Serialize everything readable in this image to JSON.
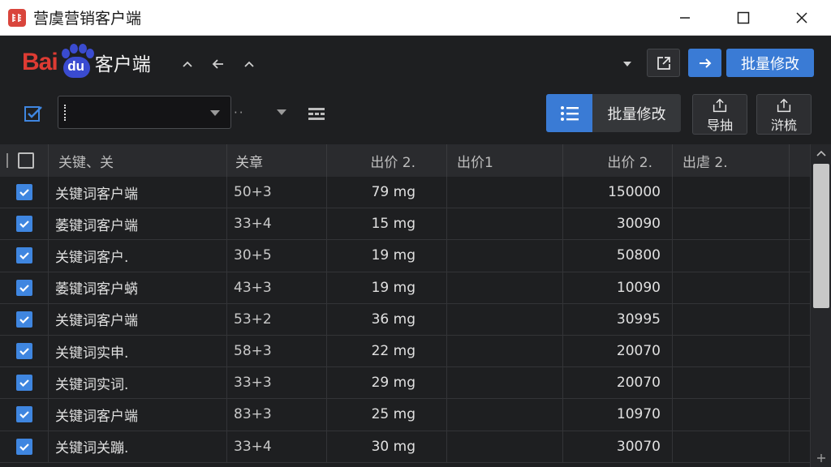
{
  "window": {
    "title": "营虞营销客户端"
  },
  "header": {
    "logo_bai": "Bai",
    "logo_du": "du",
    "logo_text": "客户端",
    "batch_edit_label": "批量修改"
  },
  "toolbar": {
    "dots": "··",
    "batch_edit_label": "批量修改",
    "export_label": "导抽",
    "more_label": "浒梳"
  },
  "table": {
    "columns": [
      "",
      "关键、关",
      "关章",
      "出价 2.",
      "出价1",
      "出价 2.",
      "出虐 2."
    ],
    "rows": [
      {
        "keyword": "关键词客户端",
        "match": "50+3",
        "dose": "79 mg",
        "bid1": "",
        "bid2": "150000",
        "bid3": ""
      },
      {
        "keyword": "萎键词客户端",
        "match": "33+4",
        "dose": "15 mg",
        "bid1": "",
        "bid2": "30090",
        "bid3": ""
      },
      {
        "keyword": "关键词客户.",
        "match": "30+5",
        "dose": "19 mg",
        "bid1": "",
        "bid2": "50800",
        "bid3": ""
      },
      {
        "keyword": "萎键词客户蜹",
        "match": "43+3",
        "dose": "19 mg",
        "bid1": "",
        "bid2": "10090",
        "bid3": ""
      },
      {
        "keyword": "关键词客户端",
        "match": "53+2",
        "dose": "36 mg",
        "bid1": "",
        "bid2": "30995",
        "bid3": ""
      },
      {
        "keyword": "关键词实申.",
        "match": "58+3",
        "dose": "22 mg",
        "bid1": "",
        "bid2": "20070",
        "bid3": ""
      },
      {
        "keyword": "关键词实词.",
        "match": "33+3",
        "dose": "29 mg",
        "bid1": "",
        "bid2": "20070",
        "bid3": ""
      },
      {
        "keyword": "关键词客户端",
        "match": "83+3",
        "dose": "25 mg",
        "bid1": "",
        "bid2": "10970",
        "bid3": ""
      },
      {
        "keyword": "关键词关蹦.",
        "match": "33+4",
        "dose": "30 mg",
        "bid1": "",
        "bid2": "30070",
        "bid3": ""
      }
    ]
  },
  "colors": {
    "accent": "#3a7bd5",
    "background": "#1e1f21",
    "brand_red": "#de3b33",
    "brand_blue": "#3a4bd0"
  }
}
